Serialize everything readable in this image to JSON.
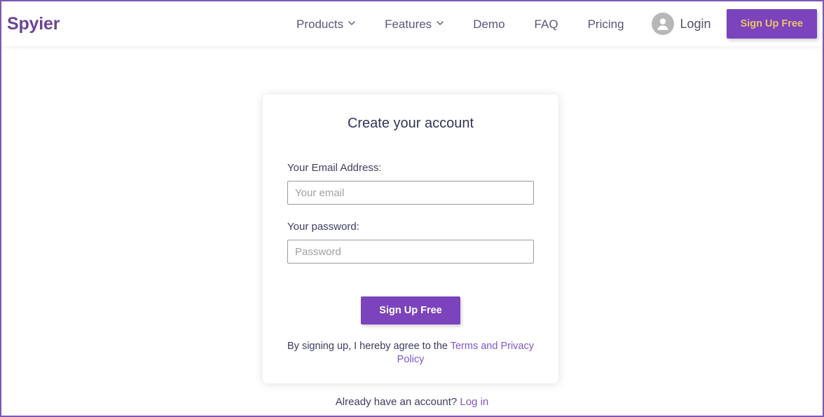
{
  "header": {
    "brand": "Spyier",
    "nav_items": [
      {
        "label": "Products",
        "has_dropdown": true,
        "icon": "chevron-down-icon"
      },
      {
        "label": "Features",
        "has_dropdown": true,
        "icon": "chevron-down-icon"
      },
      {
        "label": "Demo",
        "has_dropdown": false,
        "icon": ""
      },
      {
        "label": "FAQ",
        "has_dropdown": false,
        "icon": ""
      },
      {
        "label": "Pricing",
        "has_dropdown": false,
        "icon": ""
      }
    ],
    "login_label": "Login",
    "login_icon": "user-avatar-icon",
    "cta_label": "Sign Up Free"
  },
  "card": {
    "title": "Create your account",
    "email": {
      "label": "Your Email Address:",
      "placeholder": "Your email",
      "value": ""
    },
    "password": {
      "label": "Your password:",
      "placeholder": "Password",
      "value": ""
    },
    "submit_label": "Sign Up Free",
    "terms_prefix": "By signing up, I hereby agree to the ",
    "terms_link": "Terms and Privacy Policy"
  },
  "footer": {
    "account_prompt": "Already have an account? ",
    "login_link": "Log in"
  },
  "colors": {
    "brand_purple": "#6B4597",
    "accent_purple": "#7B43BC",
    "cta_gold": "#E9C36C",
    "link_purple": "#8156C8",
    "frame_border": "#7E57B5",
    "text_dark": "#3c3b5e"
  }
}
